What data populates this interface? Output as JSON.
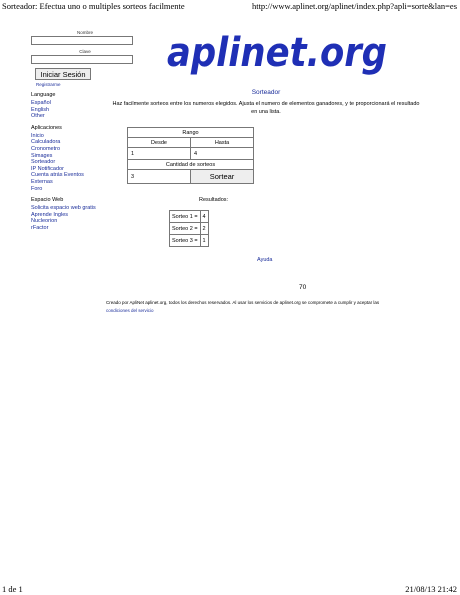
{
  "print_header": {
    "title": "Sorteador: Efectua uno o multiples sorteos facilmente",
    "url": "http://www.aplinet.org/aplinet/index.php?apli=sorte&lan=es"
  },
  "print_footer": {
    "page": "1 de 1",
    "datetime": "21/08/13 21:42"
  },
  "login": {
    "name_label": "Nombre",
    "password_label": "Clave",
    "submit_label": "Iniciar Sesión",
    "register_label": "Registrarme"
  },
  "sidebar": {
    "language_title": "Language",
    "languages": [
      "Español",
      "English",
      "Other"
    ],
    "apps_title": "Aplicaciones",
    "apps": [
      "Inicio",
      "Calculadora",
      "Cronometro",
      "Simages",
      "Sorteador",
      "IP Notificador",
      "Cuenta atrás Eventos",
      "Externas",
      "Foro"
    ],
    "web_title": "Espacio Web",
    "web_links": [
      "Solicita espacio web gratis",
      "Aprende Ingles",
      "Nucleorion",
      "rFactor"
    ]
  },
  "logo": {
    "text": "aplinet.org",
    "color": "#1f2fb5"
  },
  "main": {
    "title": "Sorteador",
    "description": "Haz facilmente sorteos entre los numeros elegidos. Ajusta el numero de elementos ganadores, y te proporcionará el resultado en una lista."
  },
  "form": {
    "range_label": "Rango",
    "from_label": "Desde",
    "to_label": "Hasta",
    "from_value": "1",
    "to_value": "4",
    "count_label": "Cantidad de sorteos",
    "count_value": "3",
    "submit_label": "Sortear"
  },
  "results": {
    "title": "Resultados:",
    "rows": [
      {
        "label": "Sorteo 1 =",
        "value": "4"
      },
      {
        "label": "Sorteo 2 =",
        "value": "2"
      },
      {
        "label": "Sorteo 3 =",
        "value": "1"
      }
    ]
  },
  "help_label": "Ayuda",
  "counter": "70",
  "credit": {
    "text": "Creado por ApliNet aplinet.org, todos los derechos reservados. Al usar los servicios de aplinet.org se compromete a cumplir y aceptar las",
    "link": "condiciones del servicio"
  }
}
